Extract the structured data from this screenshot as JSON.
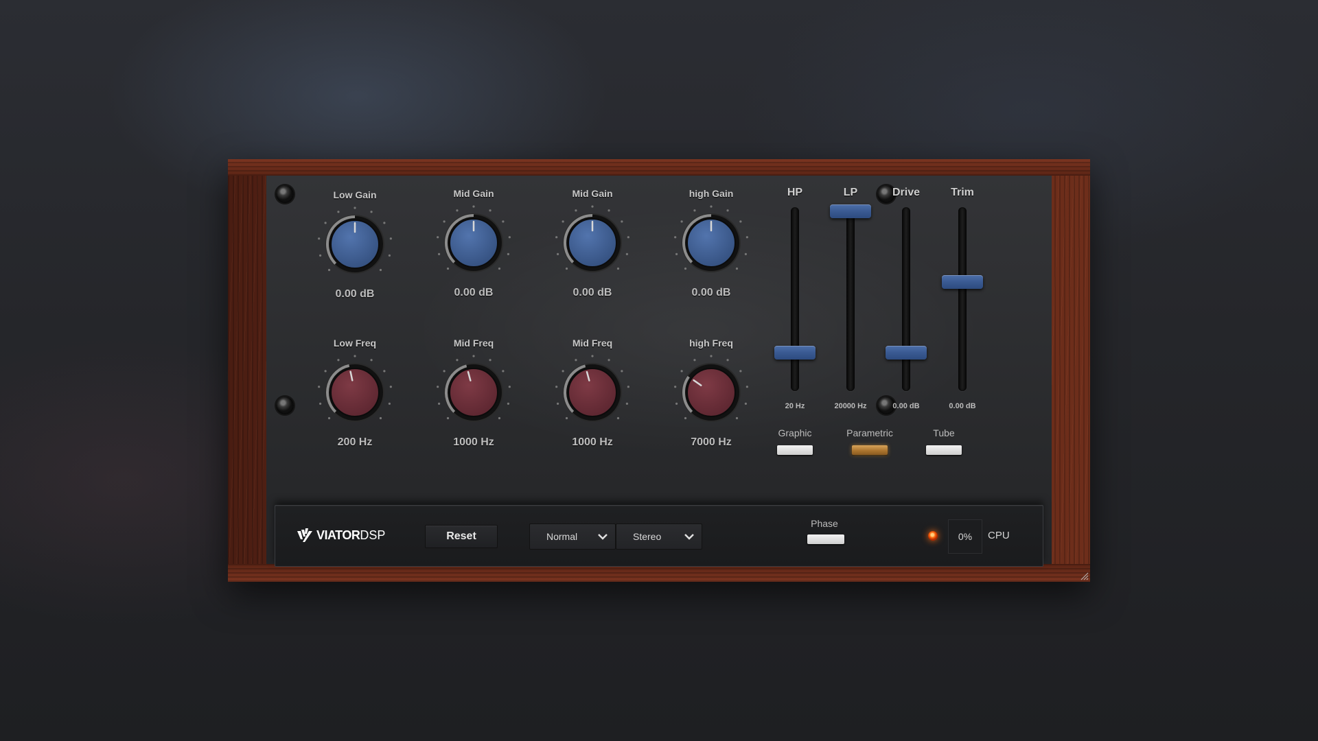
{
  "app": {
    "brand_bold": "VIATOR",
    "brand_light": "DSP"
  },
  "knobs_top": [
    {
      "label": "Low Gain",
      "value": "0.00 dB",
      "angle": 0
    },
    {
      "label": "Mid Gain",
      "value": "0.00 dB",
      "angle": 0
    },
    {
      "label": "Mid Gain",
      "value": "0.00 dB",
      "angle": 0
    },
    {
      "label": "high Gain",
      "value": "0.00 dB",
      "angle": 0
    }
  ],
  "knobs_bottom": [
    {
      "label": "Low Freq",
      "value": "200 Hz",
      "angle": -12
    },
    {
      "label": "Mid Freq",
      "value": "1000 Hz",
      "angle": -15
    },
    {
      "label": "Mid Freq",
      "value": "1000 Hz",
      "angle": -15
    },
    {
      "label": "high Freq",
      "value": "7000 Hz",
      "angle": -55
    }
  ],
  "faders": [
    {
      "title": "HP",
      "value": "20 Hz",
      "level": 0.0
    },
    {
      "title": "LP",
      "value": "20000 Hz",
      "level": 1.0
    },
    {
      "title": "Drive",
      "value": "0.00 dB",
      "level": 0.0
    },
    {
      "title": "Trim",
      "value": "0.00 dB",
      "level": 0.5
    }
  ],
  "modes": [
    {
      "label": "Graphic",
      "active": false
    },
    {
      "label": "Parametric",
      "active": true
    },
    {
      "label": "Tube",
      "active": false
    }
  ],
  "toolbar": {
    "reset_label": "Reset",
    "mode_select": "Normal",
    "channel_select": "Stereo",
    "phase_label": "Phase",
    "cpu_value": "0%",
    "cpu_label": "CPU"
  },
  "colors": {
    "gain_knob": "#34507f",
    "freq_knob": "#5c2630",
    "fader_thumb": "#3e5f98",
    "active_mode": "#c08a3e",
    "led": "#ff6a10"
  }
}
